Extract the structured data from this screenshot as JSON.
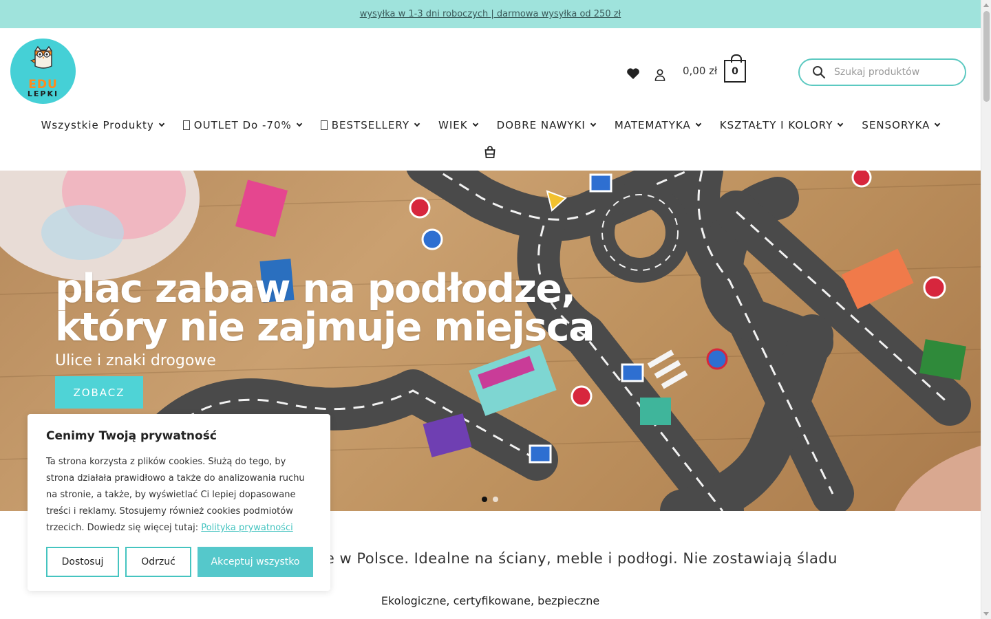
{
  "topbar": {
    "announcement": "wysyłka w 1-3 dni roboczych | darmowa wysyłka od 250 zł"
  },
  "logo": {
    "line1": "EDU",
    "line2": "LEPKI"
  },
  "header": {
    "wishlist_icon": "heart-icon",
    "account_icon": "user-icon",
    "cart_total": "0,00 zł",
    "cart_count": "0",
    "search_placeholder": "Szukaj produktów"
  },
  "nav": {
    "items": [
      {
        "label": "Wszystkie Produkty",
        "glyph": false
      },
      {
        "label": "OUTLET Do -70%",
        "glyph": true
      },
      {
        "label": "BESTSELLERY",
        "glyph": true
      },
      {
        "label": "WIEK",
        "glyph": false
      },
      {
        "label": "DOBRE NAWYKI",
        "glyph": false
      },
      {
        "label": "MATEMATYKA",
        "glyph": false
      },
      {
        "label": "KSZTAŁTY I KOLORY",
        "glyph": false
      },
      {
        "label": "SENSORYKA",
        "glyph": false
      }
    ],
    "bag_icon": "shopping-bag-icon"
  },
  "hero": {
    "title_line1": "plac zabaw na podłodze,",
    "title_line2": "który nie zajmuje miejsca",
    "subtitle": "Ulice i znaki drogowe",
    "cta": "ZOBACZ",
    "slides": 2,
    "active_slide": 1
  },
  "content": {
    "tagline": "wane w Polsce. Idealne na ściany, meble i podłogi. Nie zostawiają śladu",
    "subtagline": "Ekologiczne, certyfikowane, bezpieczne"
  },
  "cookie": {
    "title": "Cenimy Twoją prywatność",
    "body": "Ta strona korzysta z plików cookies. Służą do tego, by strona działała prawidłowo a także do analizowania ruchu na stronie, a także, by wyświetlać Ci lepiej dopasowane treści i reklamy. Stosujemy również cookies podmiotów trzecich. Dowiedz się więcej tutaj: ",
    "link": "Polityka prywatności",
    "btn_customize": "Dostosuj",
    "btn_reject": "Odrzuć",
    "btn_accept": "Akceptuj wszystko"
  },
  "colors": {
    "accent": "#45c4c0",
    "topbar": "#9fe3dc",
    "logo_bg": "#45d0d6"
  }
}
